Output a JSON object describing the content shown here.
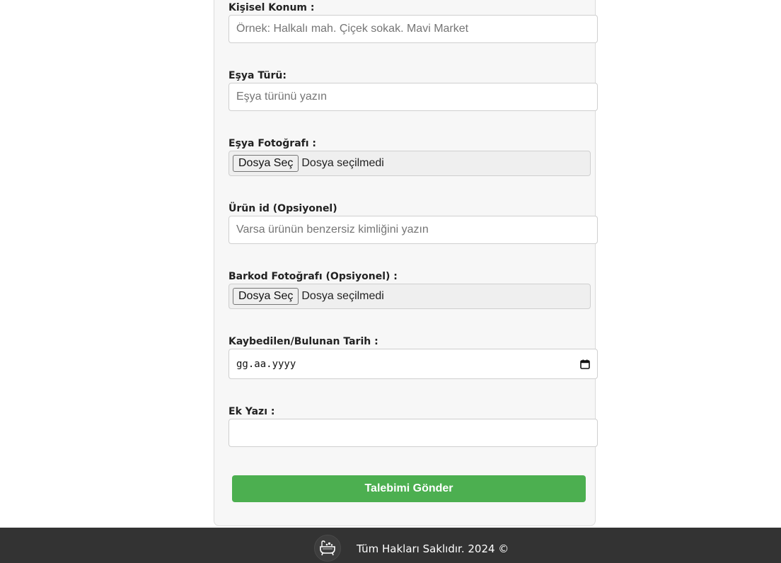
{
  "form": {
    "location": {
      "label": "Kişisel Konum :",
      "placeholder": "Örnek: Halkalı mah. Çiçek sokak. Mavi Market",
      "value": ""
    },
    "item_type": {
      "label": "Eşya Türü:",
      "placeholder": "Eşya türünü yazın",
      "value": ""
    },
    "item_photo": {
      "label": "Eşya Fotoğrafı :",
      "button_label": "Dosya Seç",
      "status": "Dosya seçilmedi"
    },
    "product_id": {
      "label": "Ürün id (Opsiyonel)",
      "placeholder": "Varsa ürünün benzersiz kimliğini yazın",
      "value": ""
    },
    "barcode_photo": {
      "label": "Barkod Fotoğrafı (Opsiyonel) :",
      "button_label": "Dosya Seç",
      "status": "Dosya seçilmedi"
    },
    "date": {
      "label": "Kaybedilen/Bulunan Tarih :",
      "placeholder": "gg.aa.yyyy",
      "icon": "calendar-icon"
    },
    "extra_note": {
      "label": "Ek Yazı :",
      "value": ""
    },
    "submit_label": "Talebimi Gönder"
  },
  "footer": {
    "logo_icon": "bathtub-logo-icon",
    "text": "Tüm Hakları Saklıdır. 2024 ©"
  },
  "colors": {
    "submit_button": "#4caf50",
    "footer_background": "#333333",
    "form_background": "#f7f7f7"
  }
}
